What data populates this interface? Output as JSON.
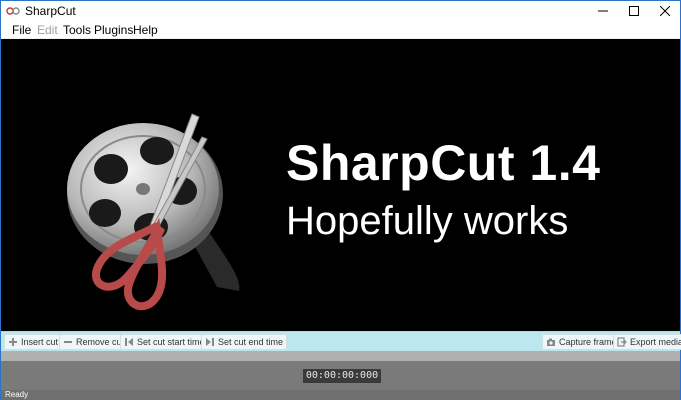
{
  "window": {
    "title": "SharpCut"
  },
  "menu": [
    {
      "label": "File",
      "enabled": true
    },
    {
      "label": "Edit",
      "enabled": false
    },
    {
      "label": "Tools",
      "enabled": true
    },
    {
      "label": "Plugins",
      "enabled": true
    },
    {
      "label": "Help",
      "enabled": true
    }
  ],
  "splash": {
    "title": "SharpCut 1.4",
    "subtitle": "Hopefully works"
  },
  "toolbar": {
    "insert_cut": "Insert cut",
    "remove_cut": "Remove cut",
    "set_cut_start": "Set cut start time",
    "set_cut_end": "Set cut end time",
    "capture_frame": "Capture frame",
    "export_media": "Export media"
  },
  "timeline": {
    "timecode": "00:00:00:000"
  },
  "status": {
    "text": "Ready"
  },
  "colors": {
    "titlebar_border": "#2b73c4",
    "toolbar_bg": "#bde7ee",
    "video_bg": "#000000"
  }
}
